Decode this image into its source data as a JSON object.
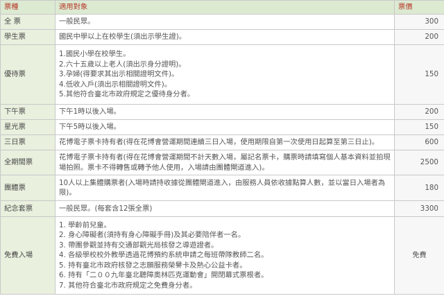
{
  "header": {
    "type": "票種",
    "audience": "適用對象",
    "price": "票價"
  },
  "rows": [
    {
      "type": "全 票",
      "audience": [
        "一般民眾。"
      ],
      "price": "300"
    },
    {
      "type": "學生票",
      "audience": [
        "國民中學以上在校學生(須出示學生證)。"
      ],
      "price": "200"
    },
    {
      "type": "優待票",
      "audience": [
        "1.國民小學在校學生。",
        "2.六十五歲以上老人(須出示身分證明)。",
        "3.孕婦(得要求其出示相關證明文件)。",
        "4.低收入戶(須出示相關證明文件)。",
        "5.其他符合臺北市政府規定之優待身分者。"
      ],
      "price": "150"
    },
    {
      "type": "下午票",
      "audience": [
        "下午1時以後入場。"
      ],
      "price": "200"
    },
    {
      "type": "星光票",
      "audience": [
        "下午5時以後入場。"
      ],
      "price": "150"
    },
    {
      "type": "三日票",
      "audience": [
        "花博電子票卡持有者(得在花博會營運期間連續三日入場，使用期限自第一次使用日起算至第三日止)。"
      ],
      "price": "600"
    },
    {
      "type": "全期間票",
      "audience": [
        "花博電子票卡持有者(得在花博會營運期間不計天數入場，屬記名票卡，購票時請填寫個人基本資料並拍現場拍照。票卡不得轉售或轉予他人使用，入場請由團體閘道進入)。"
      ],
      "price": "2500"
    },
    {
      "type": "團體票",
      "audience": [
        "10人以上集體購票者(入場時請持收據從團體閘道進入，由服務人員依收據點算人數，並以當日入場者為限)。"
      ],
      "price": "180"
    },
    {
      "type": "紀念套票",
      "audience": [
        "一般民眾。(每套含12張全票)"
      ],
      "price": "3300"
    },
    {
      "type": "免費入場",
      "audience": [
        "1. 學齡前兒童。",
        "2. 身心障礙者(須持有身心障礙手冊)及其必要陪伴者一名。",
        "3. 帶團參觀並持有交通部觀光局核發之導遊證者。",
        "4. 各級學校校外教學透過花博預約系統申請之每班帶隊教師二名。",
        "5. 持有臺北市政府核發之志願服務榮譽卡及熱心公益卡者。",
        "6. 持有「二００九年臺北聽障奧林匹克運動會」開閉幕式票根者。",
        "7. 其他符合臺北市政府規定之免費身分者。"
      ],
      "price": "免費"
    }
  ]
}
